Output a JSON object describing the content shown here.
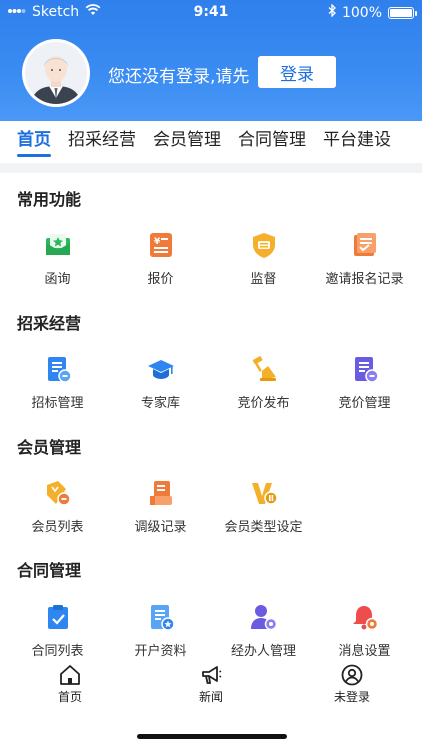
{
  "status_bar": {
    "carrier": "Sketch",
    "time": "9:41",
    "battery": "100%"
  },
  "profile": {
    "login_message": "您还没有登录,请先",
    "login_button": "登录"
  },
  "tabs": [
    {
      "label": "首页"
    },
    {
      "label": "招采经营"
    },
    {
      "label": "会员管理"
    },
    {
      "label": "合同管理"
    },
    {
      "label": "平台建设"
    }
  ],
  "sections": [
    {
      "title": "常用功能",
      "items": [
        {
          "label": "函询",
          "icon": "envelope-icon"
        },
        {
          "label": "报价",
          "icon": "quote-icon"
        },
        {
          "label": "监督",
          "icon": "supervision-shield-icon"
        },
        {
          "label": "邀请报名记录",
          "icon": "invitation-record-icon"
        }
      ]
    },
    {
      "title": "招采经营",
      "items": [
        {
          "label": "招标管理",
          "icon": "tender-document-icon"
        },
        {
          "label": "专家库",
          "icon": "graduation-cap-icon"
        },
        {
          "label": "竞价发布",
          "icon": "auction-gavel-icon"
        },
        {
          "label": "竞价管理",
          "icon": "bid-list-icon"
        }
      ]
    },
    {
      "title": "会员管理",
      "items": [
        {
          "label": "会员列表",
          "icon": "member-tag-icon"
        },
        {
          "label": "调级记录",
          "icon": "level-record-icon"
        },
        {
          "label": "会员类型设定",
          "icon": "vip-type-icon"
        }
      ]
    },
    {
      "title": "合同管理",
      "items": [
        {
          "label": "合同列表",
          "icon": "contract-clipboard-icon"
        },
        {
          "label": "开户资料",
          "icon": "account-document-icon"
        },
        {
          "label": "经办人管理",
          "icon": "user-gear-icon"
        },
        {
          "label": "消息设置",
          "icon": "bell-gear-icon"
        }
      ]
    }
  ],
  "bottom_nav": [
    {
      "label": "首页",
      "icon": "home-icon"
    },
    {
      "label": "新闻",
      "icon": "megaphone-icon"
    },
    {
      "label": "未登录",
      "icon": "user-circle-icon"
    }
  ],
  "colors": {
    "header_blue": "#3a8cf2",
    "tab_active": "#1d6fe0",
    "green": "#2cb95a",
    "orange": "#f07a3a",
    "yellow": "#f4b02a",
    "blue": "#2f86f0",
    "purple": "#6a5ce0",
    "red": "#ef4d4d"
  }
}
